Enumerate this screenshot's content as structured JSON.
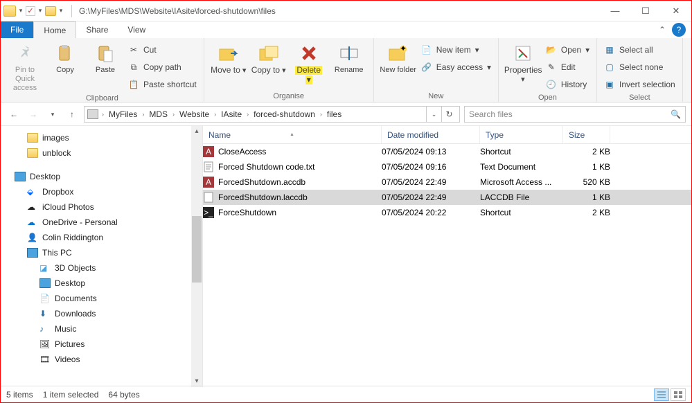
{
  "window": {
    "title_path": "G:\\MyFiles\\MDS\\Website\\IAsite\\forced-shutdown\\files"
  },
  "tabs": {
    "file": "File",
    "home": "Home",
    "share": "Share",
    "view": "View"
  },
  "ribbon": {
    "clipboard": {
      "label": "Clipboard",
      "pin": "Pin to Quick access",
      "copy": "Copy",
      "paste": "Paste",
      "cut": "Cut",
      "copy_path": "Copy path",
      "paste_shortcut": "Paste shortcut"
    },
    "organise": {
      "label": "Organise",
      "move_to": "Move to",
      "copy_to": "Copy to",
      "delete": "Delete",
      "rename": "Rename"
    },
    "new": {
      "label": "New",
      "new_folder": "New folder",
      "new_item": "New item",
      "easy_access": "Easy access"
    },
    "open": {
      "label": "Open",
      "properties": "Properties",
      "open": "Open",
      "edit": "Edit",
      "history": "History"
    },
    "select": {
      "label": "Select",
      "select_all": "Select all",
      "select_none": "Select none",
      "invert": "Invert selection"
    }
  },
  "breadcrumb": [
    "MyFiles",
    "MDS",
    "Website",
    "IAsite",
    "forced-shutdown",
    "files"
  ],
  "search": {
    "placeholder": "Search files"
  },
  "tree": {
    "images": "images",
    "unblock": "unblock",
    "desktop": "Desktop",
    "dropbox": "Dropbox",
    "icloud": "iCloud Photos",
    "onedrive": "OneDrive - Personal",
    "user": "Colin Riddington",
    "thispc": "This PC",
    "objects3d": "3D Objects",
    "desktop2": "Desktop",
    "documents": "Documents",
    "downloads": "Downloads",
    "music": "Music",
    "pictures": "Pictures",
    "videos": "Videos"
  },
  "columns": {
    "name": "Name",
    "date": "Date modified",
    "type": "Type",
    "size": "Size"
  },
  "files": [
    {
      "name": "CloseAccess",
      "date": "07/05/2024 09:13",
      "type": "Shortcut",
      "size": "2 KB",
      "icon": "shortcut-access"
    },
    {
      "name": "Forced Shutdown code.txt",
      "date": "07/05/2024 09:16",
      "type": "Text Document",
      "size": "1 KB",
      "icon": "text"
    },
    {
      "name": "ForcedShutdown.accdb",
      "date": "07/05/2024 22:49",
      "type": "Microsoft Access ...",
      "size": "520 KB",
      "icon": "access"
    },
    {
      "name": "ForcedShutdown.laccdb",
      "date": "07/05/2024 22:49",
      "type": "LACCDB File",
      "size": "1 KB",
      "icon": "lock"
    },
    {
      "name": "ForceShutdown",
      "date": "07/05/2024 20:22",
      "type": "Shortcut",
      "size": "2 KB",
      "icon": "shortcut-cmd"
    }
  ],
  "selected_index": 3,
  "status": {
    "items": "5 items",
    "selected": "1 item selected",
    "bytes": "64 bytes"
  }
}
